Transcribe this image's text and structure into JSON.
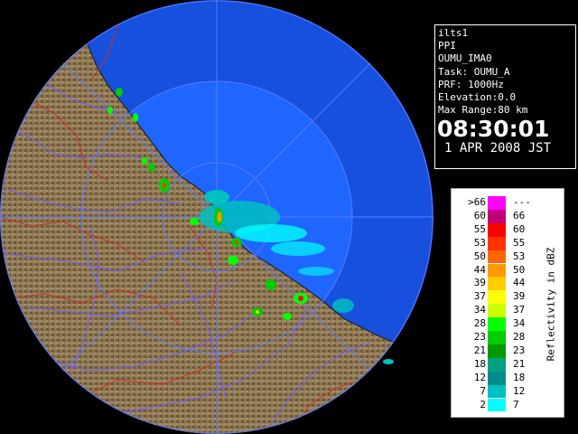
{
  "info_panel": {
    "station": "ilts1",
    "scan_type": "PPI",
    "product": "OUMU_IMA0",
    "task": "Task: OUMU_A",
    "prf": "PRF: 1000Hz",
    "elevation": "Elevation:0.0",
    "max_range": "Max Range:80 km",
    "time": "08:30:01",
    "date": "1 APR 2008 JST"
  },
  "legend": {
    "title": "Reflectivity in dBZ",
    "rows": [
      {
        "lo": ">66",
        "hi": "---",
        "color": "#ff00ff"
      },
      {
        "lo": "60",
        "hi": "66",
        "color": "#c0007a"
      },
      {
        "lo": "55",
        "hi": "60",
        "color": "#ff0000"
      },
      {
        "lo": "53",
        "hi": "55",
        "color": "#ff3300"
      },
      {
        "lo": "50",
        "hi": "53",
        "color": "#ff6600"
      },
      {
        "lo": "44",
        "hi": "50",
        "color": "#ff9900"
      },
      {
        "lo": "39",
        "hi": "44",
        "color": "#ffcc00"
      },
      {
        "lo": "37",
        "hi": "39",
        "color": "#ffff00"
      },
      {
        "lo": "34",
        "hi": "37",
        "color": "#ccff00"
      },
      {
        "lo": "28",
        "hi": "34",
        "color": "#00ff00"
      },
      {
        "lo": "23",
        "hi": "28",
        "color": "#00cc00"
      },
      {
        "lo": "21",
        "hi": "23",
        "color": "#009900"
      },
      {
        "lo": "18",
        "hi": "21",
        "color": "#00a080"
      },
      {
        "lo": "12",
        "hi": "18",
        "color": "#008c8c"
      },
      {
        "lo": "7",
        "hi": "12",
        "color": "#00c0c0"
      },
      {
        "lo": "2",
        "hi": "7",
        "color": "#00ffff"
      }
    ]
  },
  "colors": {
    "sea": "#1f66ff",
    "outer_sea": "#1650dd",
    "land": "#8a7350",
    "range_ring": "#5a7aff",
    "river": "#6f5bff",
    "boundary": "#c83020"
  }
}
